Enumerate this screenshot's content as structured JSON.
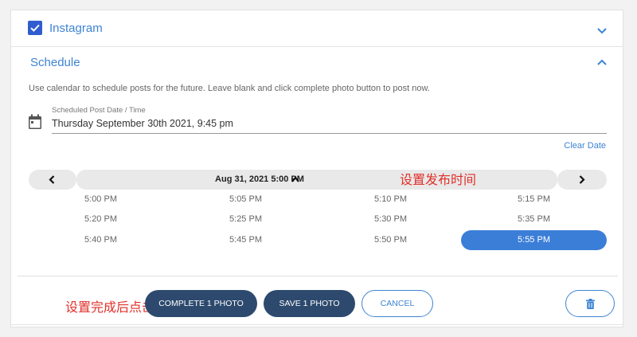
{
  "instagram": {
    "label": "Instagram",
    "checked": true
  },
  "schedule": {
    "title": "Schedule",
    "help_text": "Use calendar to schedule posts for the future. Leave blank and click complete photo button to post now.",
    "field_label": "Scheduled Post Date / Time",
    "field_value": "Thursday September 30th 2021, 9:45 pm",
    "clear_date": "Clear Date"
  },
  "time_picker": {
    "header": "Aug 31, 2021 5:00 PM",
    "slots": [
      [
        "5:00 PM",
        "5:05 PM",
        "5:10 PM",
        "5:15 PM"
      ],
      [
        "5:20 PM",
        "5:25 PM",
        "5:30 PM",
        "5:35 PM"
      ],
      [
        "5:40 PM",
        "5:45 PM",
        "5:50 PM",
        "5:55 PM"
      ]
    ],
    "selected": "5:55 PM"
  },
  "annotations": {
    "set_time": "设置发布时间",
    "after_set": "设置完成后点击"
  },
  "buttons": {
    "complete": "COMPLETE 1 PHOTO",
    "save": "SAVE 1 PHOTO",
    "cancel": "CANCEL"
  },
  "icons": {
    "checkbox": "checkbox-checked-icon",
    "chevron_down": "chevron-down-icon",
    "chevron_up": "chevron-up-icon",
    "calendar": "calendar-icon",
    "prev": "chevron-left-icon",
    "next": "chevron-right-icon",
    "header_caret": "caret-up-icon",
    "delete": "trash-icon"
  },
  "colors": {
    "accent": "#3e84d3",
    "selected_slot": "#3b7ed8",
    "dark_button": "#2d4a6e",
    "annotation": "#e0302a"
  }
}
